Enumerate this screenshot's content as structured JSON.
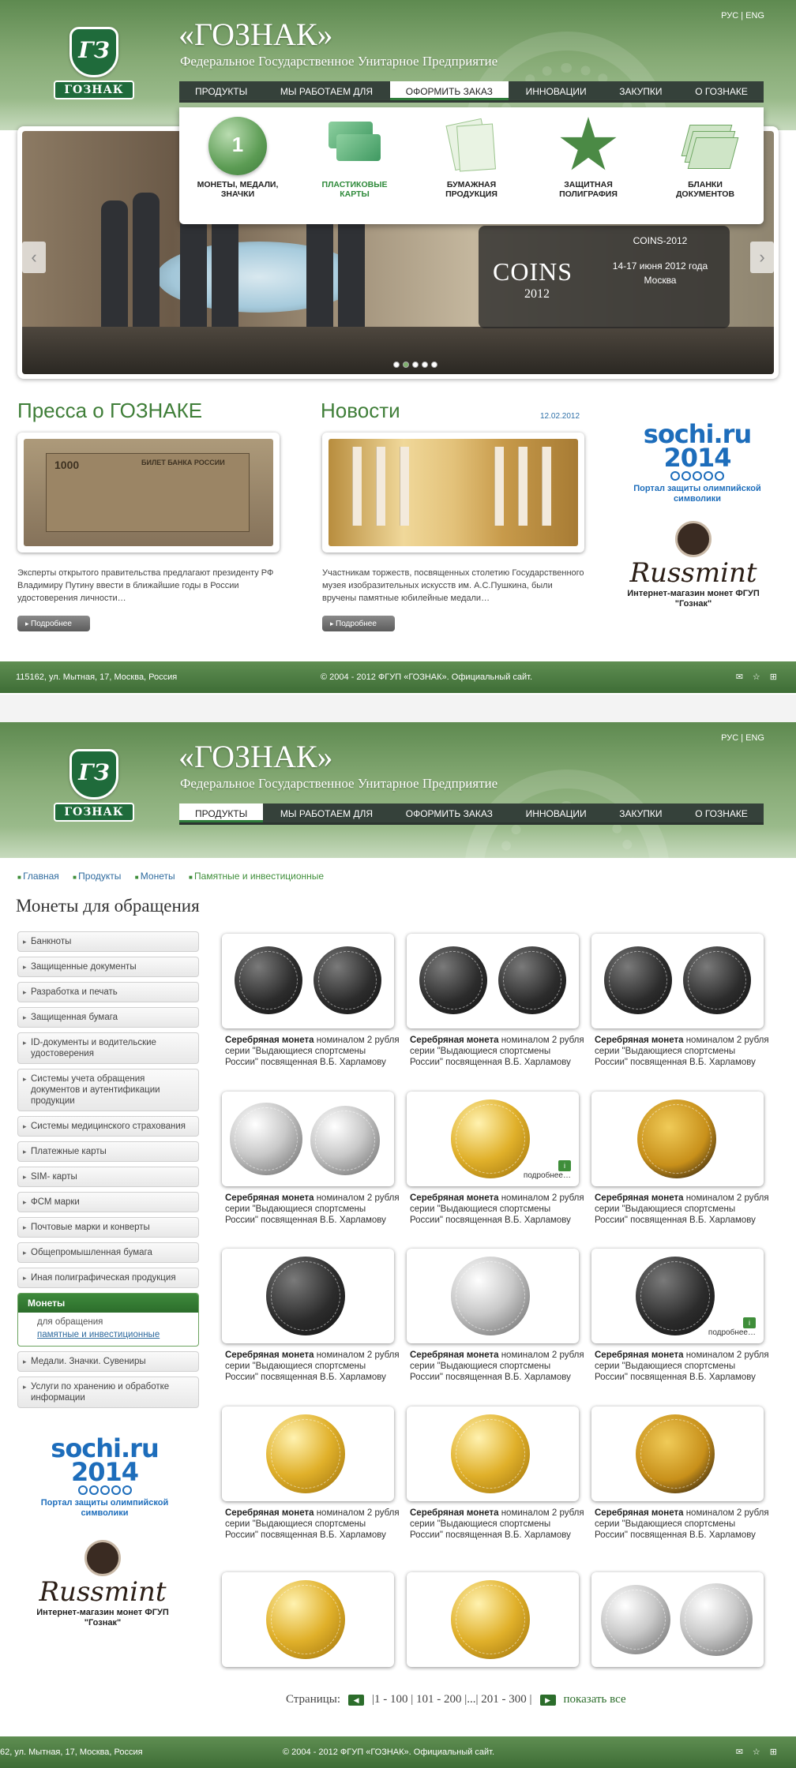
{
  "header": {
    "brand": "«ГОЗНАК»",
    "subtitle": "Федеральное Государственное Унитарное Предприятие",
    "logo_text": "ГОЗНАК",
    "lang_ru": "РУС",
    "lang_sep": "|",
    "lang_en": "ENG"
  },
  "nav": [
    "ПРОДУКТЫ",
    "МЫ РАБОТАЕМ ДЛЯ",
    "ОФОРМИТЬ ЗАКАЗ",
    "ИННОВАЦИИ",
    "ЗАКУПКИ",
    "О ГОЗНАКЕ"
  ],
  "dropdown": [
    {
      "label": "МОНЕТЫ, МЕДАЛИ, ЗНАЧКИ",
      "icon": "coin-icon"
    },
    {
      "label": "ПЛАСТИКОВЫЕ КАРТЫ",
      "icon": "cards-icon"
    },
    {
      "label": "БУМАЖНАЯ ПРОДУКЦИЯ",
      "icon": "paper-icon"
    },
    {
      "label": "ЗАЩИТНАЯ ПОЛИГРАФИЯ",
      "icon": "emblem-icon"
    },
    {
      "label": "БЛАНКИ ДОКУМЕНТОВ",
      "icon": "documents-icon"
    }
  ],
  "slider": {
    "caption_title": "COINS-2012",
    "caption_dates": "14-17 июня 2012 года",
    "caption_city": "Москва",
    "logo_word": "COINS",
    "logo_year": "2012",
    "prev": "‹",
    "next": "›"
  },
  "press": {
    "title": "Пресса о ГОЗНАКЕ",
    "text": "Эксперты открытого правительства предлагают президенту РФ Владимиру Путину ввести в ближайшие годы в России удостоверения личности…",
    "more": "Подробнее",
    "note_value": "1000",
    "note_text": "БИЛЕТ БАНКА РОССИИ"
  },
  "news": {
    "title": "Новости",
    "date": "12.02.2012",
    "text": "Участникам торжеств, посвященных столетию Государственного музея изобразительных искусств им. А.С.Пушкина, были вручены памятные юбилейные медали…",
    "more": "Подробнее"
  },
  "partners": {
    "sochi_logo": "sochi.ru 2014",
    "sochi_caption": "Портал защиты олимпийской символики",
    "russmint_logo": "Russmint",
    "russmint_caption": "Интернет-магазин монет ФГУП \"Гознак\""
  },
  "footer": {
    "address": "115162, ул. Мытная, 17, Москва, Россия",
    "copyright": "© 2004 - 2012 ФГУП «ГОЗНАК». Официальный сайт.",
    "address2": "62, ул. Мытная, 17, Москва, Россия"
  },
  "breadcrumbs": [
    "Главная",
    "Продукты",
    "Монеты",
    "Памятные и инвестиционные"
  ],
  "page_title": "Монеты для обращения",
  "sidebar": {
    "items_top": [
      "Банкноты",
      "Защищенные документы",
      "Разработка и печать",
      "Защищенная бумага",
      "ID-документы и водительские удостоверения",
      "Системы учета обращения документов и аутентификации продукции",
      "Системы медицинского страхования",
      "Платежные карты",
      "SIM- карты",
      "ФСМ марки",
      "Почтовые марки и конверты",
      "Общепромышленная бумага",
      "Иная полиграфическая продукция"
    ],
    "group_title": "Монеты",
    "group_items": [
      "для обращения",
      "памятные и инвестиционные"
    ],
    "items_bottom": [
      "Медали. Значки. Сувениры",
      "Услуги по хранению и обработке информации"
    ]
  },
  "coin_desc": {
    "bold": "Серебряная монета",
    "rest": " номиналом 2 рубля серии \"Выдающиеся спортсмены России\" посвященная В.Б. Харламову"
  },
  "coin_more": "подробнее…",
  "coin_info_icon": "i",
  "pager": {
    "label": "Страницы:",
    "ranges": "|1 - 100 | 101 - 200 |...| 201 - 300 |",
    "show_all": "показать все"
  }
}
